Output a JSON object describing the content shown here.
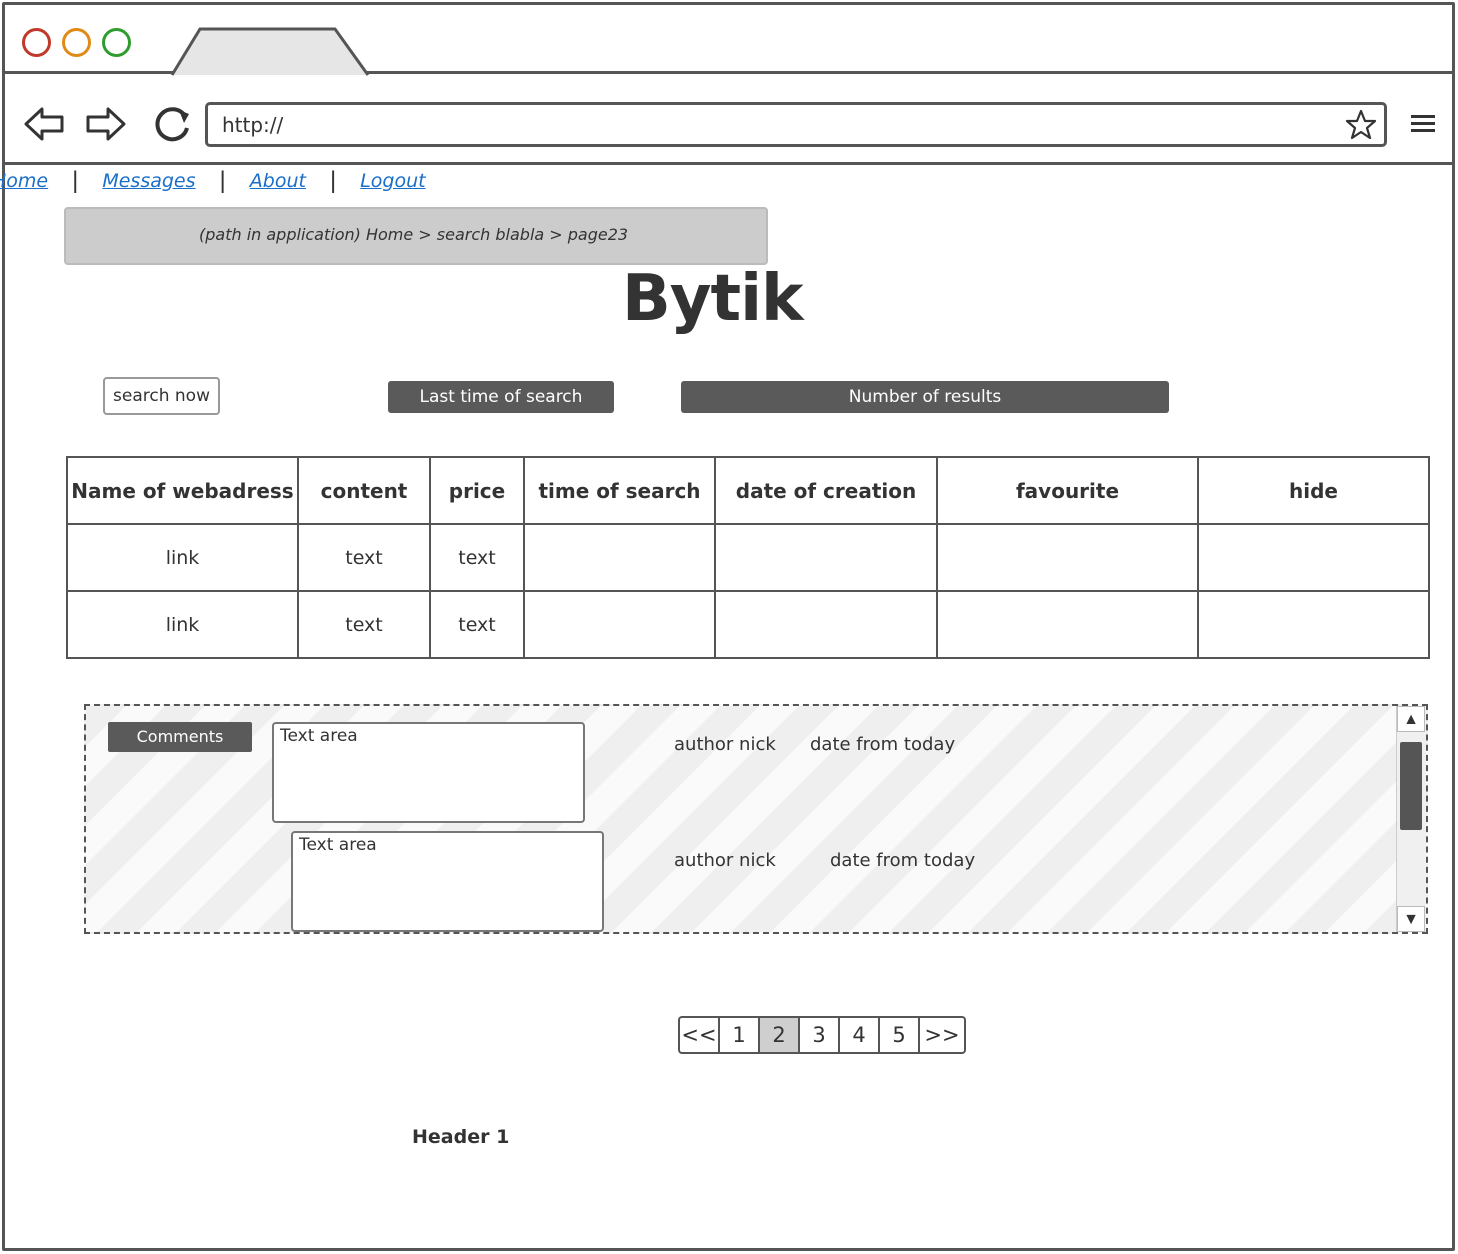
{
  "browser": {
    "url": "http://"
  },
  "nav": {
    "home": "Home",
    "messages": "Messages",
    "about": "About",
    "logout": "Logout",
    "separator": "|"
  },
  "breadcrumb": "(path in application) Home > search blabla > page23",
  "logo": "Bytik",
  "search_button": "search now",
  "last_time_label": "Last time of search",
  "number_results_label": "Number of results",
  "table": {
    "headers": [
      "Name of webadress",
      "content",
      "price",
      "time of search",
      "date of creation",
      "favourite",
      "hide"
    ],
    "rows": [
      [
        "link",
        "text",
        "text",
        "",
        "",
        "",
        ""
      ],
      [
        "link",
        "text",
        "text",
        "",
        "",
        "",
        ""
      ]
    ]
  },
  "comments": {
    "label": "Comments",
    "items": [
      {
        "text": "Text area",
        "author": "author nick",
        "date": "date from today"
      },
      {
        "text": "Text area",
        "author": "author nick",
        "date": "date from today"
      }
    ]
  },
  "pager": {
    "first": "<<",
    "pages": [
      "1",
      "2",
      "3",
      "4",
      "5"
    ],
    "active": "2",
    "last": ">>"
  },
  "footer": "Header 1"
}
